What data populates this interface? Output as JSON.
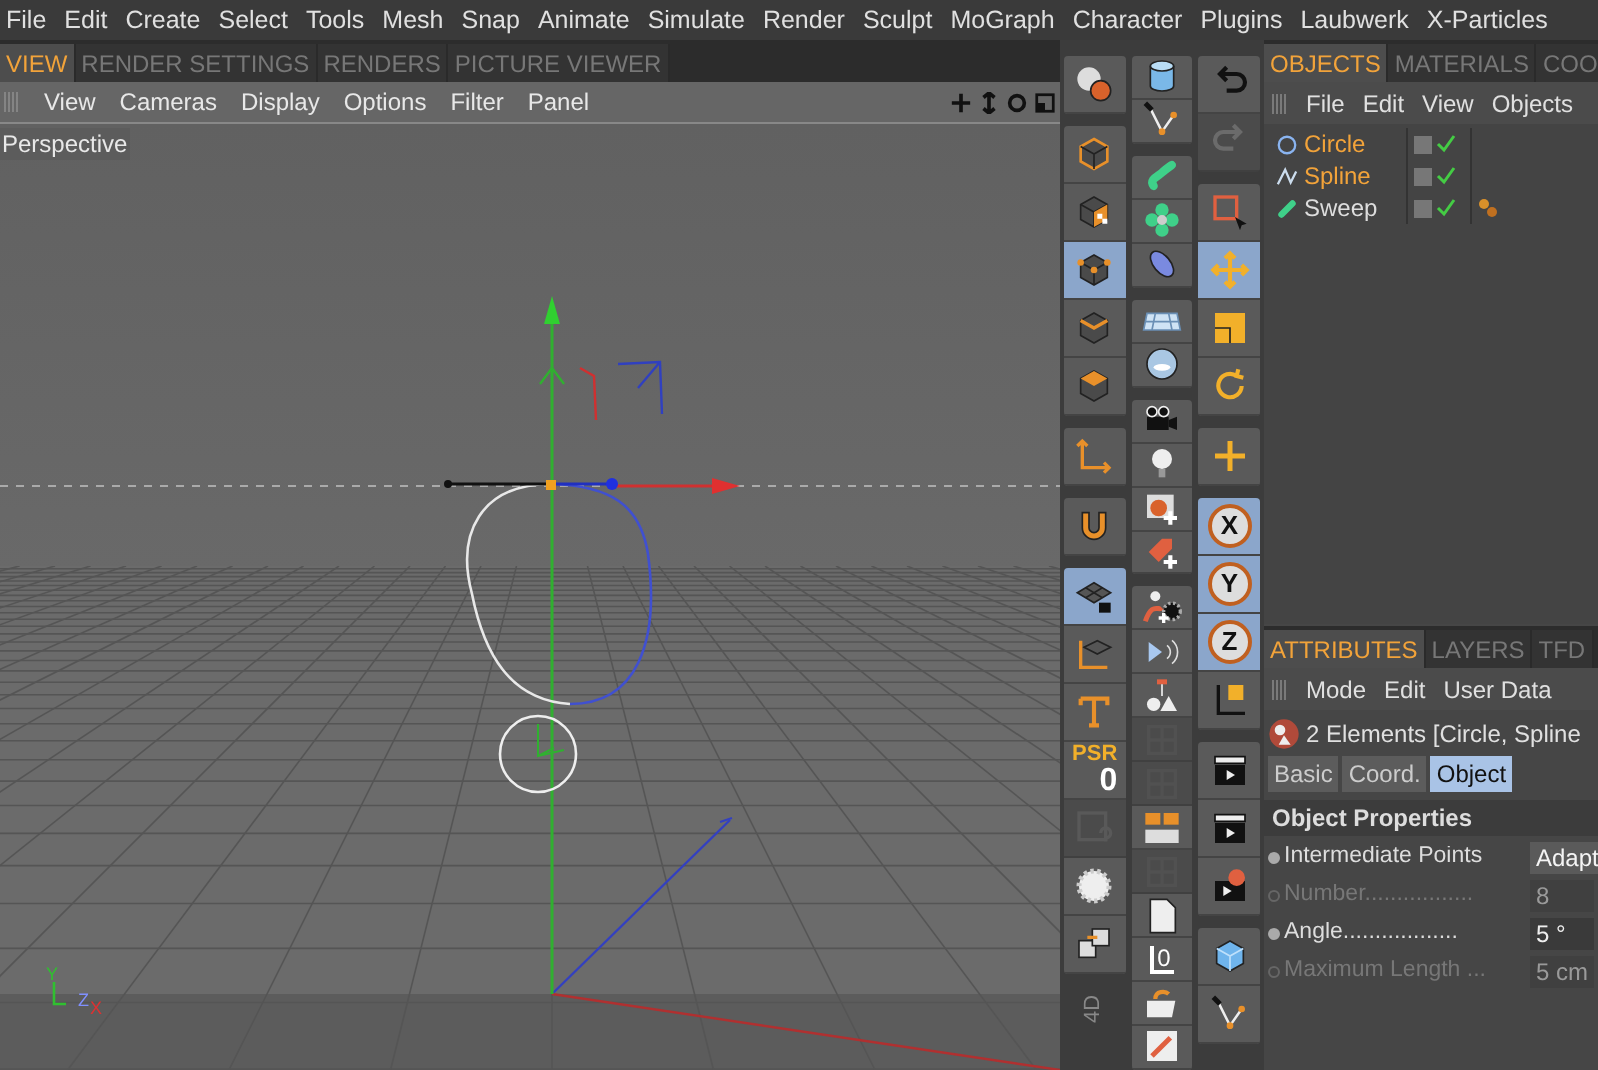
{
  "menu_bar": [
    "File",
    "Edit",
    "Create",
    "Select",
    "Tools",
    "Mesh",
    "Snap",
    "Animate",
    "Simulate",
    "Render",
    "Sculpt",
    "MoGraph",
    "Character",
    "Plugins",
    "Laubwerk",
    "X-Particles"
  ],
  "view_tabs": [
    {
      "label": "VIEW",
      "selected": true
    },
    {
      "label": "RENDER SETTINGS",
      "selected": false
    },
    {
      "label": "RENDERS",
      "selected": false
    },
    {
      "label": "PICTURE VIEWER",
      "selected": false
    }
  ],
  "viewport": {
    "menu": [
      "View",
      "Cameras",
      "Display",
      "Options",
      "Filter",
      "Panel"
    ],
    "camera_label": "Perspective",
    "axis_labels": [
      "Y",
      "Z",
      "X"
    ]
  },
  "toolbar": {
    "brand": "4D",
    "columns": [
      [
        [
          {
            "kind": "render",
            "selected": false,
            "disabled": false
          }
        ],
        [
          {
            "kind": "model",
            "selected": false,
            "disabled": false
          },
          {
            "kind": "texture",
            "selected": false,
            "disabled": false
          },
          {
            "kind": "points",
            "selected": true,
            "disabled": false
          },
          {
            "kind": "edges",
            "selected": false,
            "disabled": false
          },
          {
            "kind": "polygons",
            "selected": false,
            "disabled": false
          }
        ],
        [
          {
            "kind": "axis",
            "selected": false,
            "disabled": false
          }
        ],
        [
          {
            "kind": "magnet",
            "selected": false,
            "disabled": false
          }
        ],
        [
          {
            "kind": "gridlock",
            "selected": true,
            "disabled": false
          },
          {
            "kind": "gridaxis",
            "selected": false,
            "disabled": false
          },
          {
            "kind": "text",
            "selected": false,
            "disabled": false
          },
          {
            "kind": "psr",
            "label": "PSR",
            "value": "0",
            "selected": false,
            "disabled": false
          },
          {
            "kind": "disk",
            "selected": false,
            "disabled": true
          },
          {
            "kind": "cog",
            "selected": false,
            "disabled": false
          },
          {
            "kind": "export",
            "selected": false,
            "disabled": false
          }
        ]
      ],
      [
        [
          {
            "kind": "cylinder",
            "selected": false,
            "disabled": false
          },
          {
            "kind": "pen",
            "selected": false,
            "disabled": false
          }
        ],
        [
          {
            "kind": "sweep",
            "selected": false,
            "disabled": false
          },
          {
            "kind": "cloner",
            "selected": false,
            "disabled": false
          },
          {
            "kind": "capsule",
            "selected": false,
            "disabled": false
          }
        ],
        [
          {
            "kind": "floor",
            "selected": false,
            "disabled": false
          },
          {
            "kind": "sky",
            "selected": false,
            "disabled": false
          }
        ],
        [
          {
            "kind": "camera",
            "selected": false,
            "disabled": false
          },
          {
            "kind": "light",
            "selected": false,
            "disabled": false
          },
          {
            "kind": "tagadd",
            "selected": false,
            "disabled": false
          },
          {
            "kind": "tagred",
            "selected": false,
            "disabled": false
          }
        ],
        [
          {
            "kind": "chargear",
            "selected": false,
            "disabled": false
          },
          {
            "kind": "speaker",
            "selected": false,
            "disabled": false
          },
          {
            "kind": "figures",
            "selected": false,
            "disabled": false
          },
          {
            "kind": "generic",
            "selected": false,
            "disabled": true
          },
          {
            "kind": "generic",
            "selected": false,
            "disabled": true
          },
          {
            "kind": "folders",
            "selected": false,
            "disabled": false
          },
          {
            "kind": "generic",
            "selected": false,
            "disabled": true
          },
          {
            "kind": "document",
            "selected": false,
            "disabled": false
          },
          {
            "kind": "lzero",
            "label": "0",
            "selected": false,
            "disabled": false
          },
          {
            "kind": "folder",
            "selected": false,
            "disabled": false
          },
          {
            "kind": "rendertag",
            "selected": false,
            "disabled": false
          }
        ]
      ],
      [
        [
          {
            "kind": "undo",
            "selected": false,
            "disabled": false
          },
          {
            "kind": "redo",
            "selected": false,
            "disabled": true
          }
        ],
        [
          {
            "kind": "select",
            "selected": false,
            "disabled": false
          },
          {
            "kind": "move",
            "selected": true,
            "disabled": false
          },
          {
            "kind": "scale",
            "selected": false,
            "disabled": false
          },
          {
            "kind": "rotate",
            "selected": false,
            "disabled": false
          }
        ],
        [
          {
            "kind": "moveplus",
            "selected": false,
            "disabled": false
          }
        ],
        [
          {
            "kind": "letter",
            "label": "X",
            "selected": true,
            "disabled": false
          },
          {
            "kind": "letter",
            "label": "Y",
            "selected": true,
            "disabled": false
          },
          {
            "kind": "letter",
            "label": "Z",
            "selected": true,
            "disabled": false
          },
          {
            "kind": "axiscube",
            "selected": false,
            "disabled": false
          }
        ],
        [
          {
            "kind": "clapper",
            "selected": false,
            "disabled": false
          },
          {
            "kind": "clapper",
            "selected": false,
            "disabled": false
          },
          {
            "kind": "clappergear",
            "selected": false,
            "disabled": false
          }
        ],
        [
          {
            "kind": "bluecube",
            "selected": false,
            "disabled": false
          },
          {
            "kind": "pen",
            "selected": false,
            "disabled": false
          }
        ]
      ]
    ]
  },
  "objects_panel": {
    "tabs": [
      {
        "label": "OBJECTS",
        "selected": true
      },
      {
        "label": "MATERIALS",
        "selected": false
      },
      {
        "label": "COO",
        "selected": false
      }
    ],
    "menu": [
      "File",
      "Edit",
      "View",
      "Objects"
    ],
    "items": [
      {
        "name": "Circle",
        "kind": "circle",
        "selected": true,
        "enabled": true,
        "tagged": false
      },
      {
        "name": "Spline",
        "kind": "spline",
        "selected": true,
        "enabled": true,
        "tagged": false
      },
      {
        "name": "Sweep",
        "kind": "sweep",
        "selected": false,
        "enabled": true,
        "tagged": true
      }
    ]
  },
  "attributes_panel": {
    "tabs": [
      {
        "label": "ATTRIBUTES",
        "selected": true
      },
      {
        "label": "LAYERS",
        "selected": false
      },
      {
        "label": "TFD",
        "selected": false
      }
    ],
    "menu": [
      "Mode",
      "Edit",
      "User Data"
    ],
    "header": "2 Elements [Circle, Spline",
    "subtabs": [
      {
        "label": "Basic",
        "selected": false
      },
      {
        "label": "Coord.",
        "selected": false
      },
      {
        "label": "Object",
        "selected": true
      }
    ],
    "section": "Object Properties",
    "fields": [
      {
        "label": "Intermediate Points",
        "kind": "dropdown",
        "value": "Adapt",
        "disabled": false
      },
      {
        "label": "Number.................",
        "kind": "number",
        "value": "8",
        "disabled": true
      },
      {
        "label": "Angle..................",
        "kind": "number",
        "value": "5 °",
        "disabled": false
      },
      {
        "label": "Maximum Length ...",
        "kind": "number",
        "value": "5 cm",
        "disabled": true
      }
    ]
  }
}
